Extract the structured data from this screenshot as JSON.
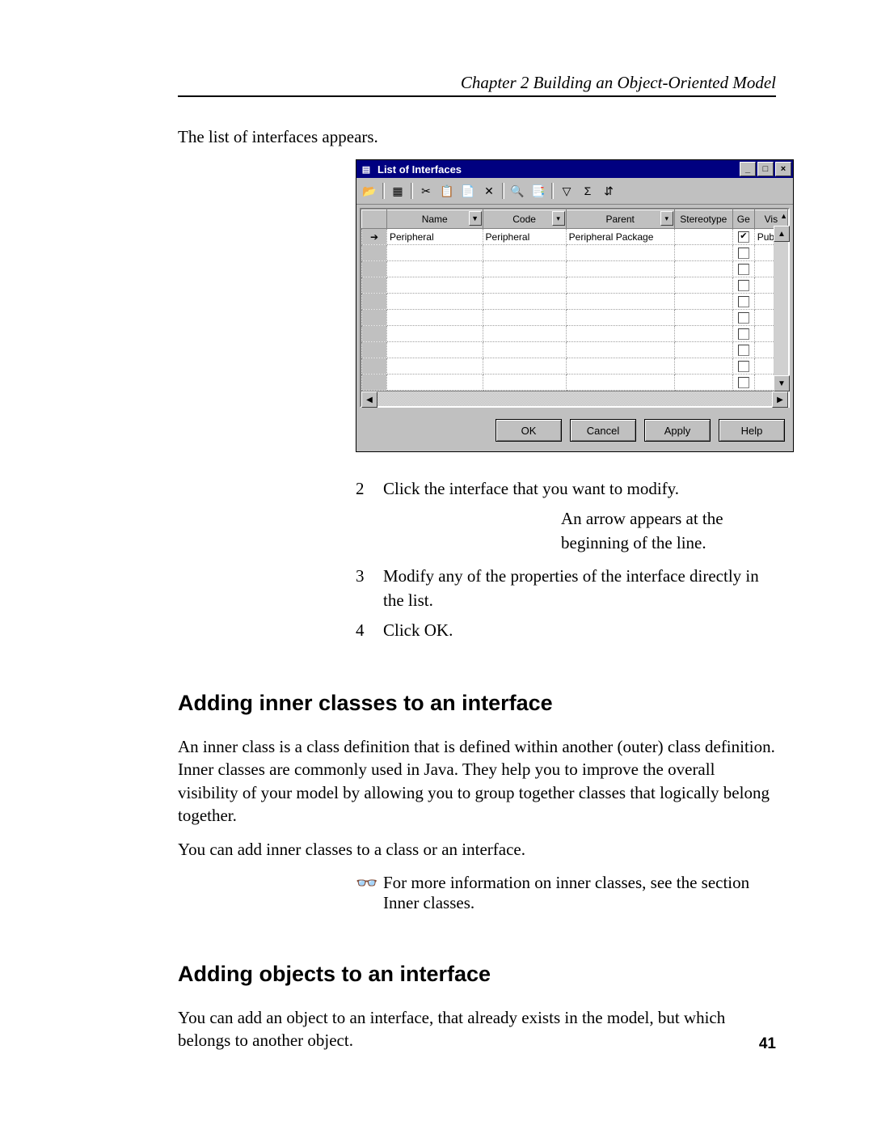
{
  "header": {
    "running_title": "Chapter 2   Building an Object-Oriented Model"
  },
  "intro_text": "The list of interfaces appears.",
  "dialog": {
    "title": "List of Interfaces",
    "window_buttons": {
      "minimize": "_",
      "maximize": "□",
      "close": "×"
    },
    "toolbar_icons": [
      "📂",
      "▦",
      "✂",
      "📋",
      "📄",
      "✕",
      "🔍",
      "📑",
      "▽",
      "Σ",
      "⇵"
    ],
    "columns": {
      "rowhdr": "",
      "name": "Name",
      "code": "Code",
      "parent": "Parent",
      "stereotype": "Stereotype",
      "ge": "Ge",
      "vis": "Vis"
    },
    "rows": [
      {
        "selected": true,
        "name": "Peripheral",
        "code": "Peripheral",
        "parent": "Peripheral Package",
        "stereotype": "",
        "ge": true,
        "vis": "Publi"
      },
      {
        "selected": false,
        "name": "",
        "code": "",
        "parent": "",
        "stereotype": "",
        "ge": false,
        "vis": ""
      },
      {
        "selected": false,
        "name": "",
        "code": "",
        "parent": "",
        "stereotype": "",
        "ge": false,
        "vis": ""
      },
      {
        "selected": false,
        "name": "",
        "code": "",
        "parent": "",
        "stereotype": "",
        "ge": false,
        "vis": ""
      },
      {
        "selected": false,
        "name": "",
        "code": "",
        "parent": "",
        "stereotype": "",
        "ge": false,
        "vis": ""
      },
      {
        "selected": false,
        "name": "",
        "code": "",
        "parent": "",
        "stereotype": "",
        "ge": false,
        "vis": ""
      },
      {
        "selected": false,
        "name": "",
        "code": "",
        "parent": "",
        "stereotype": "",
        "ge": false,
        "vis": ""
      },
      {
        "selected": false,
        "name": "",
        "code": "",
        "parent": "",
        "stereotype": "",
        "ge": false,
        "vis": ""
      },
      {
        "selected": false,
        "name": "",
        "code": "",
        "parent": "",
        "stereotype": "",
        "ge": false,
        "vis": ""
      },
      {
        "selected": false,
        "name": "",
        "code": "",
        "parent": "",
        "stereotype": "",
        "ge": false,
        "vis": ""
      }
    ],
    "buttons": {
      "ok": "OK",
      "cancel": "Cancel",
      "apply": "Apply",
      "help": "Help"
    }
  },
  "steps": [
    {
      "num": "2",
      "text": "Click the interface that you want to modify.",
      "sub": "An arrow appears at the beginning of the line."
    },
    {
      "num": "3",
      "text": "Modify any of the properties of the interface directly in the list."
    },
    {
      "num": "4",
      "text": "Click OK."
    }
  ],
  "section1": {
    "heading": "Adding inner classes to an interface",
    "para1": "An inner class is a class definition that is defined within another (outer) class definition. Inner classes are commonly used in Java. They help you to improve the overall visibility of your model by allowing you to group together classes that logically belong together.",
    "para2": "You can add inner classes to a class or an interface.",
    "ref": "For more information on inner classes, see the section Inner classes."
  },
  "section2": {
    "heading": "Adding objects to an interface",
    "para1": "You can add an object to an interface, that already exists in the model, but which belongs to another object."
  },
  "page_number": "41",
  "icons": {
    "arrow_right": "➔",
    "ref_glasses": "👓"
  }
}
